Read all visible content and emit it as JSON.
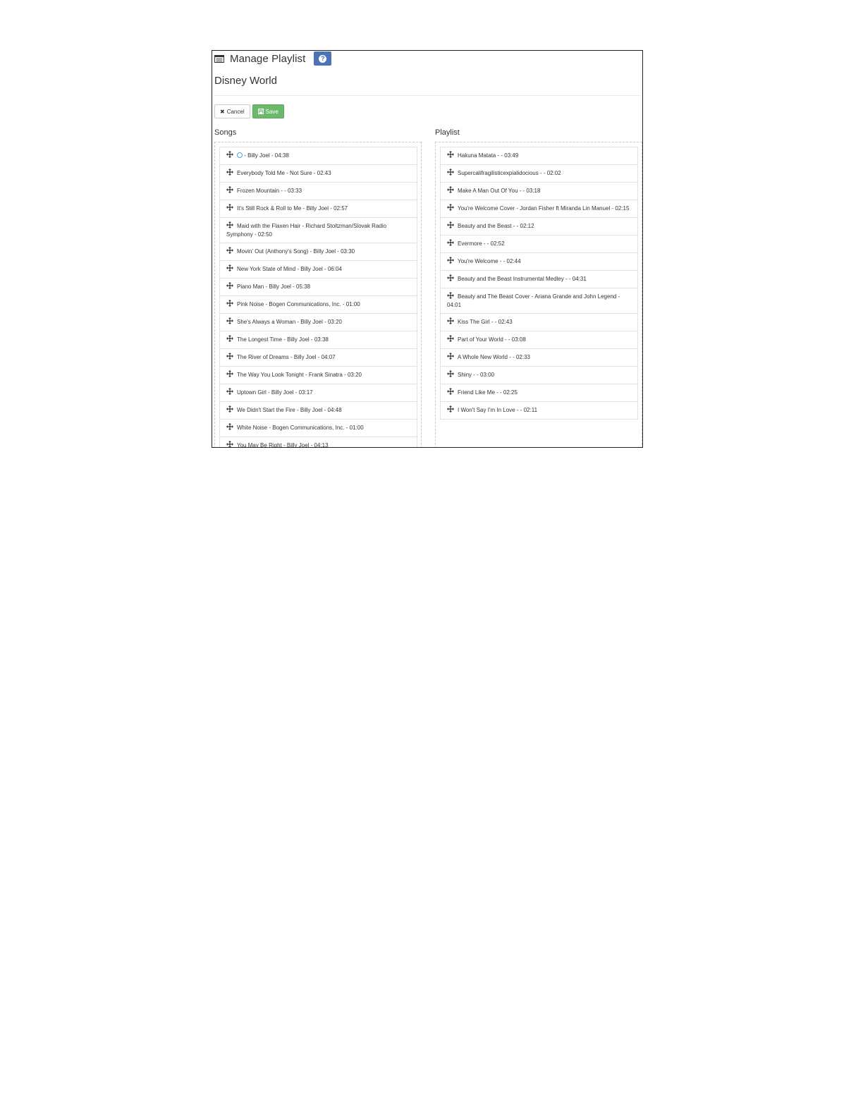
{
  "header": {
    "title": "Manage Playlist",
    "title_icon": "list-window-icon",
    "help_icon": "question-circle-icon"
  },
  "playlist_name": "Disney World",
  "toolbar": {
    "cancel_label": "Cancel",
    "cancel_icon": "times-icon",
    "save_label": "Save",
    "save_icon": "floppy-disk-icon"
  },
  "colors": {
    "help_button": "#4a73b8",
    "save_button": "#6cb96c"
  },
  "songs": {
    "label": "Songs",
    "items": [
      {
        "label": "- Billy Joel - 04:38",
        "prefix_icon": "music-circle-icon"
      },
      {
        "label": "Everybody Told Me - Not Sure - 02:43"
      },
      {
        "label": "Frozen Mountain - - 03:33"
      },
      {
        "label": "It's Still Rock & Roll to Me - Billy Joel - 02:57"
      },
      {
        "label": "Maid with the Flaxen Hair - Richard Stoltzman/Slovak Radio Symphony - 02:50"
      },
      {
        "label": "Movin' Out (Anthony's Song) - Billy Joel - 03:30"
      },
      {
        "label": "New York State of Mind - Billy Joel - 06:04"
      },
      {
        "label": "Piano Man - Billy Joel - 05:38"
      },
      {
        "label": "Pink Noise - Bogen Communications, Inc. - 01:00"
      },
      {
        "label": "She's Always a Woman - Billy Joel - 03:20"
      },
      {
        "label": "The Longest Time - Billy Joel - 03:38"
      },
      {
        "label": "The River of Dreams - Billy Joel - 04:07"
      },
      {
        "label": "The Way You Look Tonight - Frank Sinatra - 03:20"
      },
      {
        "label": "Uptown Girl - Billy Joel - 03:17"
      },
      {
        "label": "We Didn't Start the Fire - Billy Joel - 04:48"
      },
      {
        "label": "White Noise - Bogen Communications, Inc. - 01:00"
      },
      {
        "label": "You May Be Right - Billy Joel - 04:13"
      }
    ]
  },
  "playlist": {
    "label": "Playlist",
    "items": [
      {
        "label": "Hakuna Matata - - 03:49"
      },
      {
        "label": "Supercalifragilisticexpialidocious - - 02:02"
      },
      {
        "label": "Make A Man Out Of You - - 03:18"
      },
      {
        "label": "You're Welcome Cover - Jordan Fisher ft Miranda Lin Manuel - 02:15"
      },
      {
        "label": "Beauty and the Beast - - 02:12"
      },
      {
        "label": "Evermore - - 02:52"
      },
      {
        "label": "You're Welcome - - 02:44"
      },
      {
        "label": "Beauty and the Beast Instrumental Medley - - 04:31"
      },
      {
        "label": "Beauty and The Beast Cover - Ariana Grande and John Legend - 04:01"
      },
      {
        "label": "Kiss The Girl - - 02:43"
      },
      {
        "label": "Part of Your World - - 03:08"
      },
      {
        "label": "A Whole New World - - 02:33"
      },
      {
        "label": "Shiny - - 03:00"
      },
      {
        "label": "Friend Like Me - - 02:25"
      },
      {
        "label": "I Won't Say I'm In Love - - 02:11"
      }
    ]
  }
}
